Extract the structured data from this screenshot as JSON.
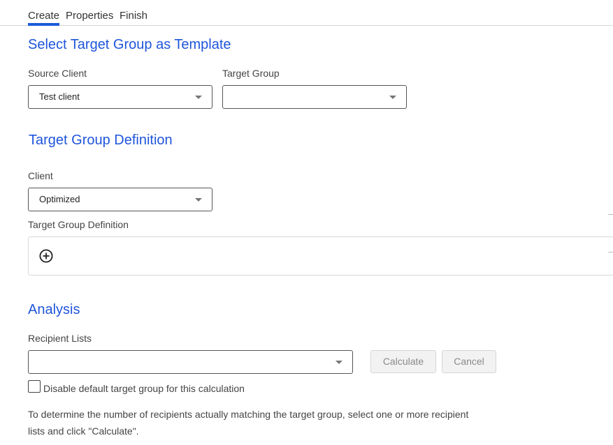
{
  "tabs": [
    {
      "label": "Create",
      "active": true
    },
    {
      "label": "Properties",
      "active": false
    },
    {
      "label": "Finish",
      "active": false
    }
  ],
  "template_section": {
    "title": "Select Target Group as Template",
    "source_client_label": "Source Client",
    "source_client_value": "Test client",
    "target_group_label": "Target Group",
    "target_group_value": ""
  },
  "definition_section": {
    "title": "Target Group Definition",
    "client_label": "Client",
    "client_value": "Optimized",
    "definition_label": "Target Group Definition",
    "add_icon": "plus-circle-icon"
  },
  "analysis_section": {
    "title": "Analysis",
    "recipient_lists_label": "Recipient Lists",
    "recipient_lists_value": "",
    "calculate_label": "Calculate",
    "cancel_label": "Cancel",
    "disable_default_label": "Disable default target group for this calculation",
    "disable_default_checked": false,
    "info_text": "To determine the number of recipients actually matching the target group, select one or more recipient lists and click \"Calculate\"."
  },
  "colors": {
    "accent": "#1f55dc",
    "tab_underline": "#1a5bd9"
  }
}
